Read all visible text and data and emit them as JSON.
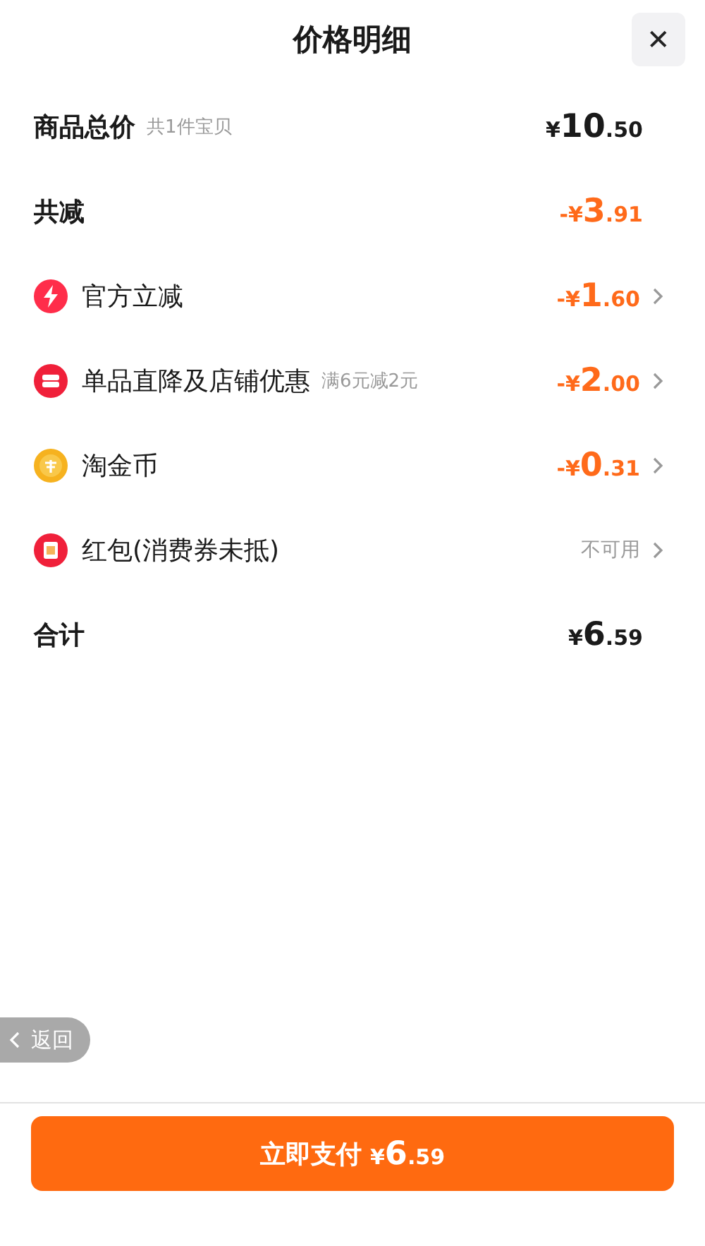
{
  "header": {
    "title": "价格明细",
    "close_label": "✕"
  },
  "rows": [
    {
      "kind": "summary",
      "label": "商品总价",
      "note": "共1件宝贝",
      "amount": {
        "prefix": "¥",
        "main": "10",
        "fraction": ".50"
      }
    },
    {
      "kind": "saving",
      "label": "共减",
      "amount": {
        "prefix": "-¥",
        "main": "3",
        "fraction": ".91"
      }
    },
    {
      "kind": "item",
      "label": "官方立减",
      "amount": {
        "prefix": "-¥",
        "main": "1",
        "fraction": ".60"
      }
    },
    {
      "kind": "item",
      "label": "单品直降及店铺优惠",
      "note": "满6元减2元",
      "amount": {
        "prefix": "-¥",
        "main": "2",
        "fraction": ".00"
      }
    },
    {
      "kind": "item",
      "label": "淘金币",
      "amount": {
        "prefix": "-¥",
        "main": "0",
        "fraction": ".31"
      }
    },
    {
      "kind": "status",
      "label": "红包(消费券未抵)",
      "status": "不可用"
    },
    {
      "kind": "summary",
      "label": "合计",
      "amount": {
        "prefix": "¥",
        "main": "6",
        "fraction": ".59"
      }
    }
  ],
  "back_button": "返回",
  "pay_button": {
    "label": "立即支付",
    "amount": {
      "prefix": "¥",
      "main": "6",
      "fraction": ".59"
    }
  }
}
